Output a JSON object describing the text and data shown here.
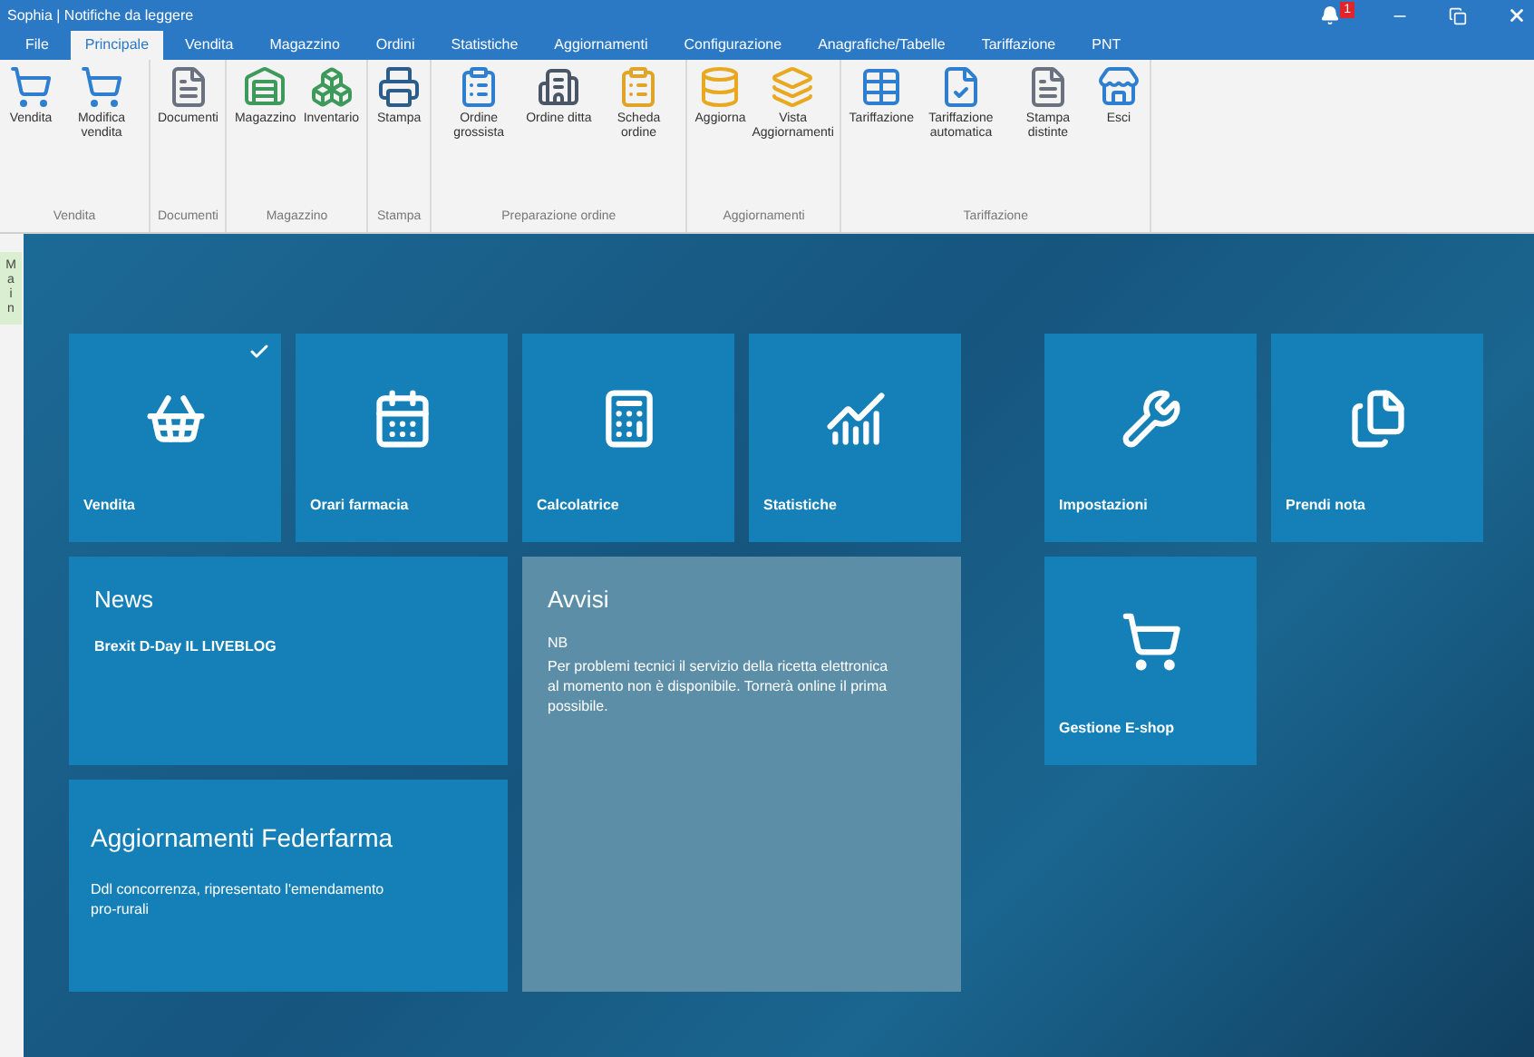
{
  "window": {
    "title": "Sophia | Notifiche da leggere",
    "notification_count": "1"
  },
  "tabs": [
    {
      "label": "File",
      "selected": false
    },
    {
      "label": "Principale",
      "selected": true
    },
    {
      "label": "Vendita",
      "selected": false
    },
    {
      "label": "Magazzino",
      "selected": false
    },
    {
      "label": "Ordini",
      "selected": false
    },
    {
      "label": "Statistiche",
      "selected": false
    },
    {
      "label": "Aggiornamenti",
      "selected": false
    },
    {
      "label": "Configurazione",
      "selected": false
    },
    {
      "label": "Anagrafiche/Tabelle",
      "selected": false
    },
    {
      "label": "Tariffazione",
      "selected": false
    },
    {
      "label": "PNT",
      "selected": false
    }
  ],
  "ribbon": {
    "groups": [
      {
        "label": "Vendita",
        "buttons": [
          "Vendita",
          "Modifica vendita"
        ]
      },
      {
        "label": "Documenti",
        "buttons": [
          "Documenti"
        ]
      },
      {
        "label": "Magazzino",
        "buttons": [
          "Magazzino",
          "Inventario"
        ]
      },
      {
        "label": "Stampa",
        "buttons": [
          "Stampa"
        ]
      },
      {
        "label": "Preparazione ordine",
        "buttons": [
          "Ordine grossista",
          "Ordine ditta",
          "Scheda ordine"
        ]
      },
      {
        "label": "Aggiornamenti",
        "buttons": [
          "Aggiorna",
          "Vista Aggiornamenti"
        ]
      },
      {
        "label": "Tariffazione",
        "buttons": [
          "Tariffazione",
          "Tariffazione automatica",
          "Stampa distinte",
          "Esci"
        ]
      }
    ]
  },
  "side_tab": "Main",
  "apps": [
    {
      "label": "Vendita",
      "checked": true
    },
    {
      "label": "Orari farmacia",
      "checked": false
    },
    {
      "label": "Calcolatrice",
      "checked": false
    },
    {
      "label": "Statistiche",
      "checked": false
    }
  ],
  "right_apps": [
    {
      "label": "Impostazioni",
      "checked": false
    },
    {
      "label": "Prendi nota",
      "checked": false
    },
    {
      "label": "Gestione E-shop",
      "checked": false
    }
  ],
  "news": {
    "title": "News",
    "text": "Brexit D-Day IL LIVEBLOG"
  },
  "notices": {
    "title": "Avvisi",
    "lines": [
      "NB",
      "Per problemi tecnici il servizio della ricetta elettronica al momento non è disponibile. Tornerà online il prima possibile."
    ]
  },
  "federfarma": {
    "title": "Aggiornamenti Federfarma",
    "text": "Ddl concorrenza, ripresentato l'emendamento pro-rurali"
  }
}
